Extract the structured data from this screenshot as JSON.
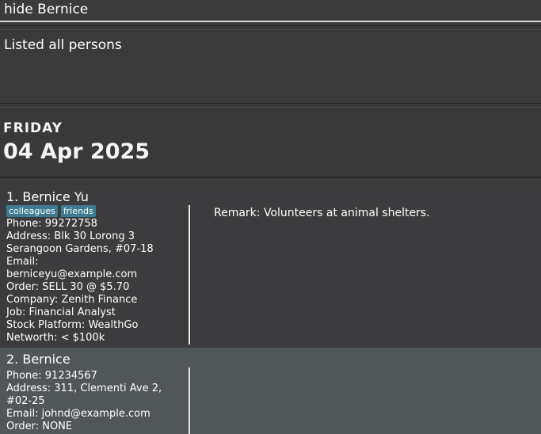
{
  "command": {
    "value": "hide Bernice"
  },
  "result": {
    "text": "Listed all persons"
  },
  "date_panel": {
    "day": "FRIDAY",
    "date": "04 Apr 2025"
  },
  "persons": [
    {
      "name": "1. Bernice Yu",
      "tags": [
        "colleagues",
        "friends"
      ],
      "phone": "Phone: 99272758",
      "address_lines": [
        "Address: Blk 30 Lorong 3",
        "Serangoon Gardens, #07-18"
      ],
      "email_lines": [
        "Email:",
        "berniceyu@example.com"
      ],
      "order": "Order: SELL 30 @ $5.70",
      "company": "Company: Zenith Finance",
      "job": "Job: Financial Analyst",
      "stock_platform": "Stock Platform: WealthGo",
      "networth": "Networth: < $100k",
      "remark": "Remark: Volunteers at animal shelters."
    },
    {
      "name": "2. Bernice",
      "tags": [],
      "phone": "Phone: 91234567",
      "address_lines": [
        "Address: 311, Clementi Ave 2,",
        "#02-25"
      ],
      "email_lines": [
        "Email: johnd@example.com"
      ],
      "order": "Order: NONE"
    }
  ],
  "colors": {
    "background": "#3a3a3a",
    "tag": "#3e7b91",
    "selected_card": "#515658"
  }
}
